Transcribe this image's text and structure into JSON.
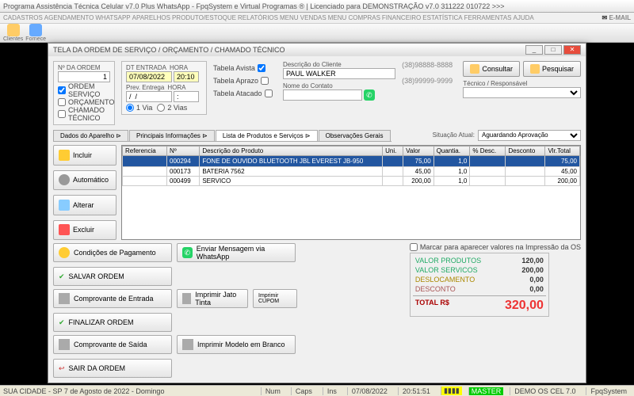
{
  "app": {
    "title": "Programa Assistência Técnica Celular v7.0 Plus WhatsApp - FpqSystem e Virtual Programas ® | Licenciado para  DEMONSTRAÇÃO v7.0 311222 010722 >>>"
  },
  "menu": [
    "CADASTROS",
    "AGENDAMENTO",
    "WHATSAPP",
    "APARELHOS",
    "PRODUTO/ESTOQUE",
    "RELATÓRIOS",
    "MENU VENDAS",
    "MENU COMPRAS",
    "FINANCEIRO",
    "ESTATÍSTICA",
    "FERRAMENTAS",
    "AJUDA"
  ],
  "menu_email": "E-MAIL",
  "toolbar_left": [
    "Clientes",
    "Fornece"
  ],
  "modal": {
    "title": "TELA DA ORDEM DE SERVIÇO / ORÇAMENTO / CHAMADO TÉCNICO",
    "order_no_lbl": "Nº DA ORDEM",
    "order_no": "1",
    "chk_os": "ORDEM SERVIÇO",
    "chk_orc": "ORÇAMENTO",
    "chk_ct": "CHAMADO TÉCNICO",
    "dt_lbl": "DT ENTRADA",
    "hora_lbl": "HORA",
    "dt": "07/08/2022",
    "hora": "20:10",
    "prev_lbl": "Prev. Entrega",
    "prev_dt": "/  /",
    "prev_hora": ":",
    "via1": "1 Via",
    "via2": "2 Vias",
    "tb_avista": "Tabela Avista",
    "tb_aprazo": "Tabela Aprazo",
    "tb_atacado": "Tabela Atacado",
    "desc_cli_lbl": "Descrição do Cliente",
    "desc_cli": "PAUL WALKER",
    "contato_lbl": "Nome do Contato",
    "contato": "",
    "tel1": "(38)98888-8888",
    "tel2": "(38)99999-9999",
    "tec_lbl": "Técnico / Responsável",
    "btn_consultar": "Consultar",
    "btn_pesquisar": "Pesquisar",
    "tabs": [
      "Dados do Aparelho ⊳",
      "Principais Informações ⊳",
      "Lista de Produtos e Serviços ⊳",
      "Observações Gerais"
    ],
    "active_tab": 2,
    "sit_lbl": "Situação Atual:",
    "sit_val": "Aguardando Aprovação",
    "side": {
      "incluir": "Incluir",
      "auto": "Automático",
      "alterar": "Alterar",
      "excluir": "Excluir"
    },
    "grid_cols": [
      "Referencia",
      "Nº",
      "Descrição do Produto",
      "Uni.",
      "Valor",
      "Quantia.",
      "% Desc.",
      "Desconto",
      "Vlr.Total"
    ],
    "grid_rows": [
      {
        "ref": "",
        "num": "000294",
        "desc": "FONE DE OUVIDO BLUETOOTH JBL EVEREST JB-950",
        "uni": "",
        "valor": "75,00",
        "qt": "1,0",
        "pdesc": "",
        "desc2": "",
        "tot": "75,00",
        "sel": true
      },
      {
        "ref": "",
        "num": "000173",
        "desc": "BATERIA 7562",
        "uni": "",
        "valor": "45,00",
        "qt": "1,0",
        "pdesc": "",
        "desc2": "",
        "tot": "45,00"
      },
      {
        "ref": "",
        "num": "000499",
        "desc": "SERVICO",
        "uni": "",
        "valor": "200,00",
        "qt": "1,0",
        "pdesc": "",
        "desc2": "",
        "tot": "200,00"
      }
    ],
    "btns": {
      "cond": "Condições de Pagamento",
      "whats": "Enviar Mensagem via WhatsApp",
      "salvar": "SALVAR ORDEM",
      "comp_ent": "Comprovante de Entrada",
      "jato": "Imprimir Jato Tinta",
      "cupom": "Imprimir CUPOM",
      "finalizar": "FINALIZAR ORDEM",
      "comp_sai": "Comprovante de Saída",
      "branco": "Imprimir Modelo em Branco",
      "sair": "SAIR DA ORDEM"
    },
    "marcar": "Marcar para aparecer valores na Impressão da OS",
    "totals": {
      "prod_k": "VALOR PRODUTOS",
      "prod_v": "120,00",
      "serv_k": "VALOR SERVICOS",
      "serv_v": "200,00",
      "desl_k": "DESLOCAMENTO",
      "desl_v": "0,00",
      "desc_k": "DESCONTO",
      "desc_v": "0,00",
      "tot_k": "TOTAL R$",
      "tot_v": "320,00"
    }
  },
  "status": {
    "left": "SUA CIDADE - SP  7 de Agosto de 2022 - Domingo",
    "num": "Num",
    "caps": "Caps",
    "ins": "Ins",
    "date": "07/08/2022",
    "time": "20:51:51",
    "master": "MASTER",
    "demo": "DEMO OS CEL 7.0",
    "brand": "FpqSystem"
  }
}
